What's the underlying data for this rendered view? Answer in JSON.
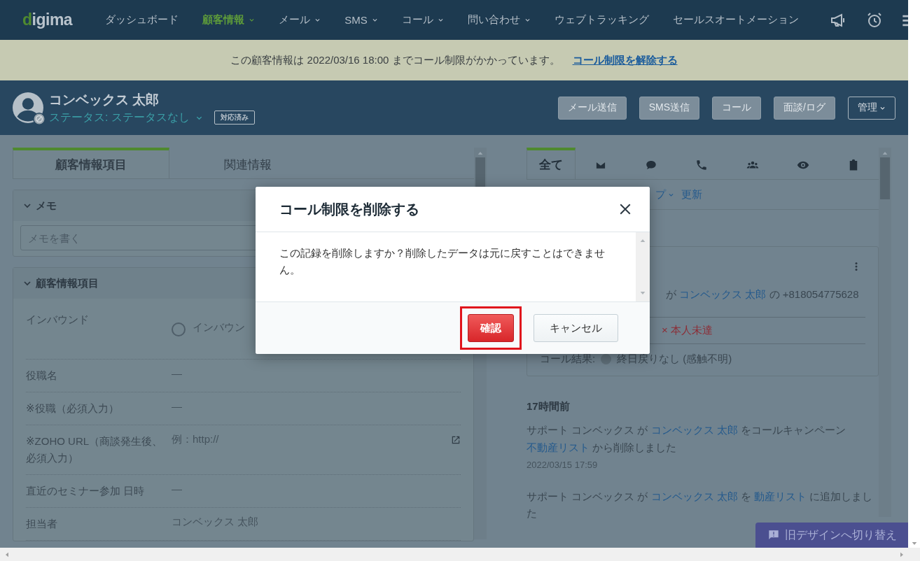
{
  "nav": {
    "logo": "digima",
    "items": [
      {
        "label": "ダッシュボード",
        "selected": false,
        "dropdown": false
      },
      {
        "label": "顧客情報",
        "selected": true,
        "dropdown": true
      },
      {
        "label": "メール",
        "selected": false,
        "dropdown": true
      },
      {
        "label": "SMS",
        "selected": false,
        "dropdown": true
      },
      {
        "label": "コール",
        "selected": false,
        "dropdown": true
      },
      {
        "label": "問い合わせ",
        "selected": false,
        "dropdown": true
      },
      {
        "label": "ウェブトラッキング",
        "selected": false,
        "dropdown": false
      },
      {
        "label": "セールスオートメーション",
        "selected": false,
        "dropdown": false
      }
    ]
  },
  "notice": {
    "text": "この顧客情報は 2022/03/16 18:00 までコール制限がかかっています。",
    "link": "コール制限を解除する"
  },
  "customer": {
    "name": "コンベックス 太郎",
    "status": "ステータス: ステータスなし",
    "badge": "対応済み",
    "actions": [
      {
        "label": "メール送信",
        "kind": "button"
      },
      {
        "label": "SMS送信",
        "kind": "button"
      },
      {
        "label": "コール",
        "kind": "button"
      },
      {
        "label": "面談/ログ",
        "kind": "button"
      },
      {
        "label": "管理",
        "kind": "dropdown"
      }
    ]
  },
  "left_panel": {
    "tabs": [
      {
        "label": "顧客情報項目",
        "selected": true
      },
      {
        "label": "関連情報",
        "selected": false
      }
    ],
    "memo": {
      "title": "メモ",
      "expanded": true,
      "placeholder": "メモを書く"
    },
    "info": {
      "title": "顧客情報項目",
      "expanded": true,
      "fields": [
        {
          "label": "インバウンド",
          "kind": "radio",
          "value": "インバウン",
          "checked": false
        },
        {
          "label": "役職名",
          "kind": "text",
          "value": "—"
        },
        {
          "label": "※役職（必須入力）",
          "kind": "text",
          "value": "—"
        },
        {
          "label": "※ZOHO URL（商談発生後、必須入力）",
          "kind": "url",
          "value": "例：http://"
        },
        {
          "label": "直近のセミナー参加 日時",
          "kind": "text",
          "value": "—"
        },
        {
          "label": "担当者",
          "kind": "text",
          "value": "コンベックス 太郎"
        }
      ]
    }
  },
  "right_panel": {
    "tabs": [
      {
        "kind": "text",
        "label": "全て",
        "selected": true
      },
      {
        "kind": "icon",
        "selected": false
      },
      {
        "kind": "icon",
        "selected": false
      },
      {
        "kind": "icon",
        "selected": false
      },
      {
        "kind": "icon",
        "selected": false
      },
      {
        "kind": "icon",
        "selected": false
      },
      {
        "kind": "icon",
        "selected": false
      }
    ],
    "filter": {
      "label": "プ",
      "link": "更新"
    },
    "call_card": {
      "parts": [
        {
          "text": "が",
          "kind": "text"
        },
        {
          "text": "コンベックス 太郎",
          "kind": "link"
        },
        {
          "text": "の +818054775628",
          "kind": "text"
        }
      ],
      "result": "× 本人未達",
      "call_result_label": "コール結果:",
      "call_result": "終日戻りなし (感触不明)"
    },
    "entries": [
      {
        "time": "17時間前",
        "parts": [
          {
            "text": "サポート コンベックス が ",
            "kind": "text"
          },
          {
            "text": "コンベックス 太郎",
            "kind": "link"
          },
          {
            "text": " をコールキャンペーン ",
            "kind": "text"
          },
          {
            "text": "不動産リスト",
            "kind": "link"
          },
          {
            "text": " から削除しました",
            "kind": "text"
          }
        ],
        "date": "2022/03/15 17:59"
      },
      {
        "parts": [
          {
            "text": "サポート コンベックス が ",
            "kind": "text"
          },
          {
            "text": "コンベックス 太郎",
            "kind": "link"
          },
          {
            "text": " を ",
            "kind": "text"
          },
          {
            "text": "動産リスト",
            "kind": "link"
          },
          {
            "text": " に追加しました",
            "kind": "text"
          }
        ]
      }
    ]
  },
  "switch_button": "旧デザインへ切り替え",
  "modal": {
    "title": "コール制限を削除する",
    "message": "この記録を削除しますか？削除したデータは元に戻すことはできません。",
    "buttons": [
      {
        "label": "確認",
        "kind": "primary",
        "highlighted": true
      },
      {
        "label": "キャンセル",
        "kind": "secondary",
        "highlighted": false
      }
    ]
  }
}
